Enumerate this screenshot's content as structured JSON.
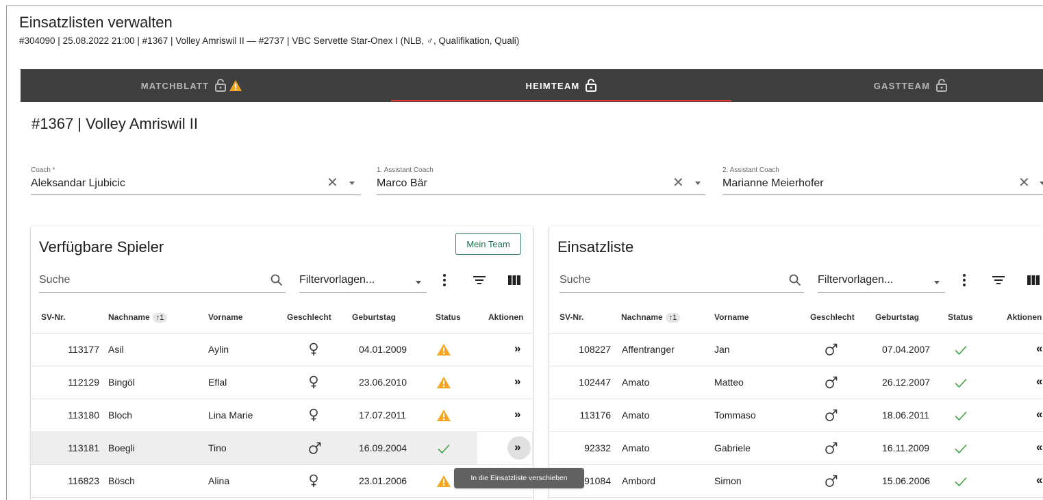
{
  "page": {
    "title": "Einsatzlisten verwalten",
    "match_info": "#304090 | 25.08.2022 21:00 | #1367 | Volley Amriswil II — #2737 | VBC Servette Star-Onex I (NLB, ♂, Qualifikation, Quali)"
  },
  "tabs": [
    {
      "label": "MATCHBLATT",
      "icons": [
        "lock-open-icon",
        "warning-icon"
      ]
    },
    {
      "label": "HEIMTEAM",
      "icons": [
        "lock-open-icon"
      ],
      "active": true
    },
    {
      "label": "GASTTEAM",
      "icons": [
        "lock-open-icon"
      ]
    }
  ],
  "team_title": "#1367 | Volley Amriswil II",
  "coaches": [
    {
      "label": "Coach *",
      "value": "Aleksandar Ljubicic"
    },
    {
      "label": "1. Assistant Coach",
      "value": "Marco Bär"
    },
    {
      "label": "2. Assistant Coach",
      "value": "Marianne Meierhofer"
    }
  ],
  "available": {
    "title": "Verfügbare Spieler",
    "mein_team_label": "Mein Team",
    "search_placeholder": "Suche",
    "filter_placeholder": "Filtervorlagen...",
    "columns": [
      "SV-Nr.",
      "Nachname",
      "Vorname",
      "Geschlecht",
      "Geburtstag",
      "Status",
      "Aktionen"
    ],
    "sort_badge": "1",
    "rows": [
      {
        "svnr": "113177",
        "nachname": "Asil",
        "vorname": "Aylin",
        "gender": "female",
        "geburtstag": "04.01.2009",
        "status": "warning",
        "action": "»"
      },
      {
        "svnr": "112129",
        "nachname": "Bingöl",
        "vorname": "Eflal",
        "gender": "female",
        "geburtstag": "23.06.2010",
        "status": "warning",
        "action": "»"
      },
      {
        "svnr": "113180",
        "nachname": "Bloch",
        "vorname": "Lina Marie",
        "gender": "female",
        "geburtstag": "17.07.2011",
        "status": "warning",
        "action": "»"
      },
      {
        "svnr": "113181",
        "nachname": "Boegli",
        "vorname": "Tino",
        "gender": "male",
        "geburtstag": "16.09.2004",
        "status": "ok",
        "action": "»",
        "hovered": true
      },
      {
        "svnr": "116823",
        "nachname": "Bösch",
        "vorname": "Alina",
        "gender": "female",
        "geburtstag": "23.01.2006",
        "status": "warning",
        "action": "»"
      }
    ]
  },
  "einsatz": {
    "title": "Einsatzliste",
    "search_placeholder": "Suche",
    "filter_placeholder": "Filtervorlagen...",
    "columns": [
      "SV-Nr.",
      "Nachname",
      "Vorname",
      "Geschlecht",
      "Geburtstag",
      "Status",
      "Aktionen"
    ],
    "sort_badge": "1",
    "rows": [
      {
        "svnr": "108227",
        "nachname": "Affentranger",
        "vorname": "Jan",
        "gender": "male",
        "geburtstag": "07.04.2007",
        "status": "ok",
        "action": "«"
      },
      {
        "svnr": "102447",
        "nachname": "Amato",
        "vorname": "Matteo",
        "gender": "male",
        "geburtstag": "26.12.2007",
        "status": "ok",
        "action": "«"
      },
      {
        "svnr": "113176",
        "nachname": "Amato",
        "vorname": "Tommaso",
        "gender": "male",
        "geburtstag": "18.06.2011",
        "status": "ok",
        "action": "«"
      },
      {
        "svnr": "92332",
        "nachname": "Amato",
        "vorname": "Gabriele",
        "gender": "male",
        "geburtstag": "16.11.2009",
        "status": "ok",
        "action": "«"
      },
      {
        "svnr": "91084",
        "nachname": "Ambord",
        "vorname": "Simon",
        "gender": "male",
        "geburtstag": "15.06.2006",
        "status": "ok",
        "action": "«"
      }
    ]
  },
  "tooltip": "In die Einsatzliste verschieben",
  "colors": {
    "warning": "#f5a623",
    "ok": "#43a047",
    "accent": "#e53935",
    "tabbar": "#3f3f3f",
    "button": "#2e7d5b"
  }
}
